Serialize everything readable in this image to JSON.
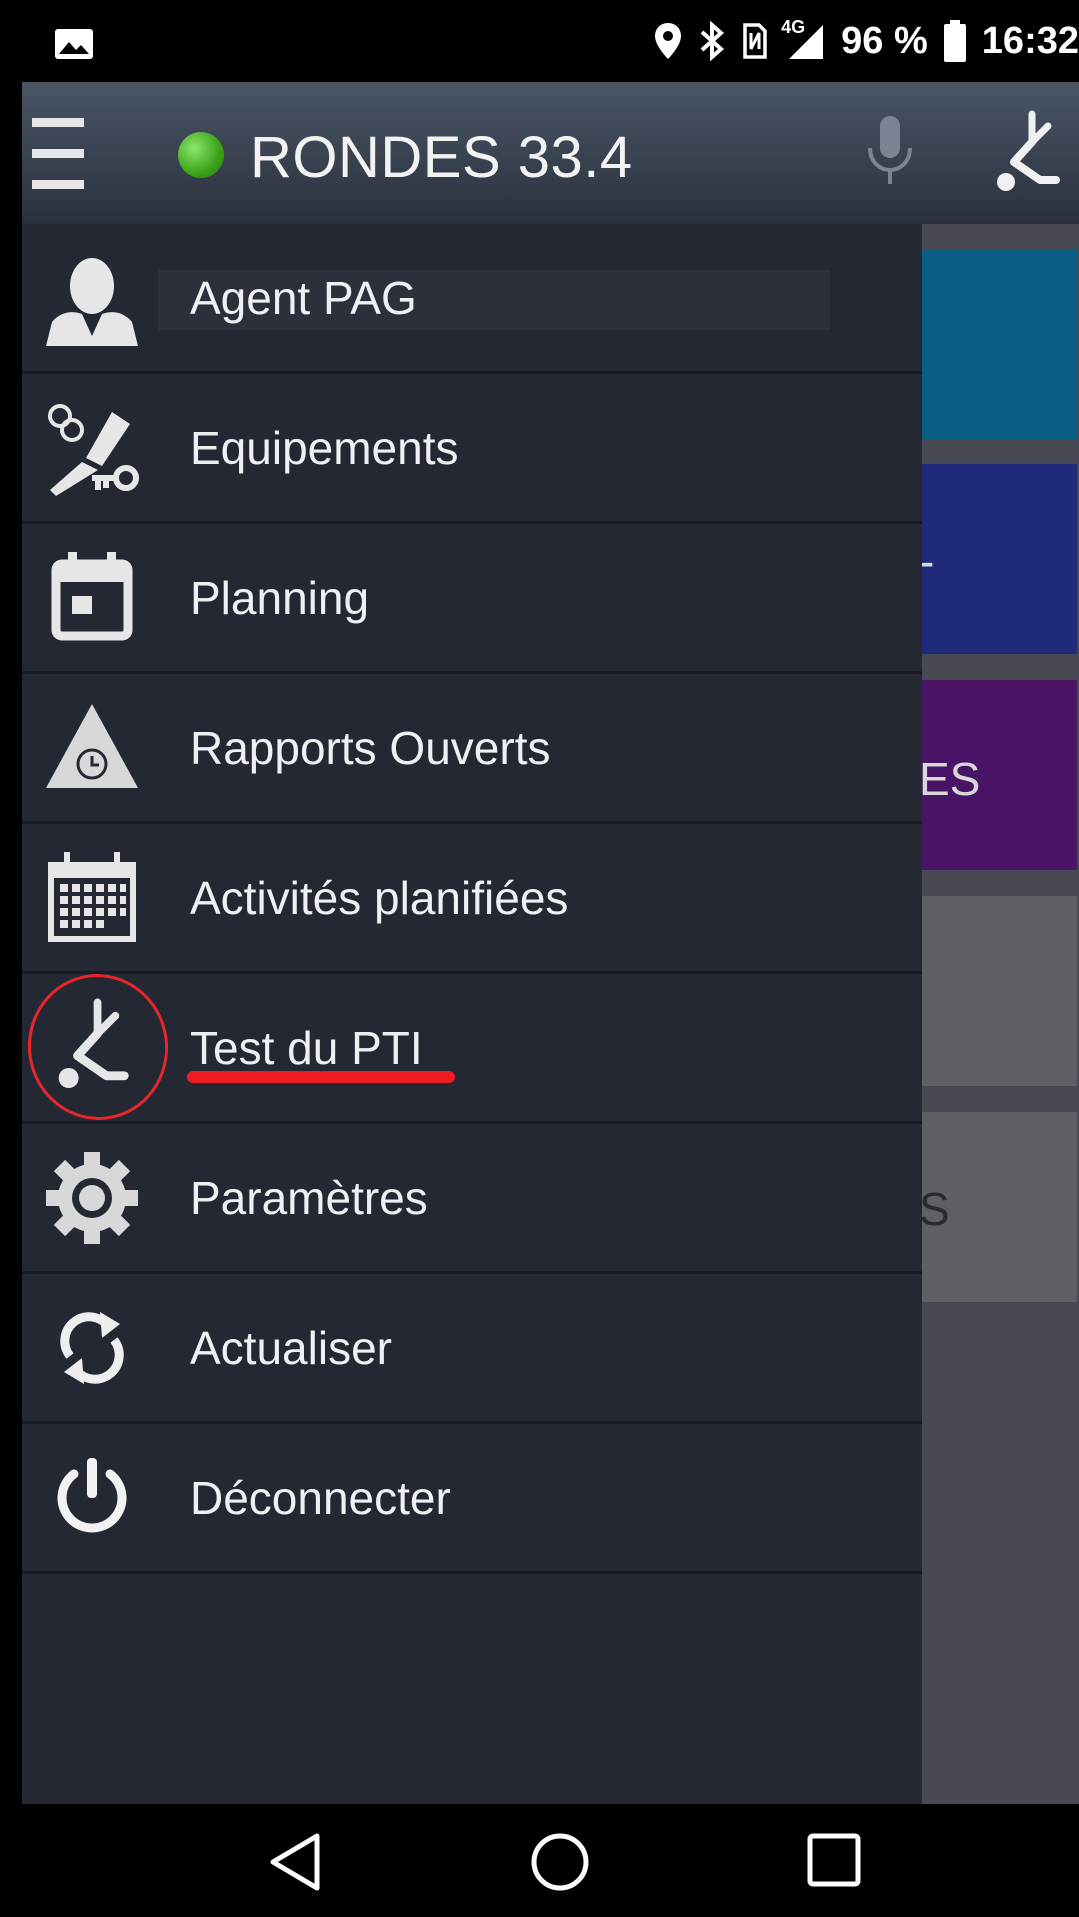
{
  "status_bar": {
    "left_icon": "image-notification-icon",
    "icons": [
      "location-icon",
      "bluetooth-icon",
      "nfc-icon",
      "signal-4g-icon"
    ],
    "network_label": "4G",
    "battery": "96 %",
    "time": "16:32"
  },
  "app_bar": {
    "title": "RONDES 33.4",
    "status_color": "#3aa318"
  },
  "drawer": {
    "items": [
      {
        "label": "Agent PAG",
        "icon": "agent-icon"
      },
      {
        "label": "Equipements",
        "icon": "equipment-icon"
      },
      {
        "label": "Planning",
        "icon": "calendar-icon"
      },
      {
        "label": "Rapports Ouverts",
        "icon": "report-warning-icon"
      },
      {
        "label": "Activités planifiées",
        "icon": "calendar-grid-icon"
      },
      {
        "label": "Test du PTI",
        "icon": "man-down-icon"
      },
      {
        "label": "Paramètres",
        "icon": "gear-icon"
      },
      {
        "label": "Actualiser",
        "icon": "refresh-icon"
      },
      {
        "label": "Déconnecter",
        "icon": "power-icon"
      }
    ]
  },
  "background_tiles": [
    {
      "color": "#0a5e86",
      "text": ""
    },
    {
      "color": "#1f2a7a",
      "text": "-"
    },
    {
      "color": "#4a1466",
      "text": "ES"
    },
    {
      "color": "#5f6066",
      "text": ""
    },
    {
      "color": "#5f6066",
      "text": "S"
    }
  ],
  "annotation": {
    "color": "#ee1c24",
    "target": "Test du PTI"
  }
}
